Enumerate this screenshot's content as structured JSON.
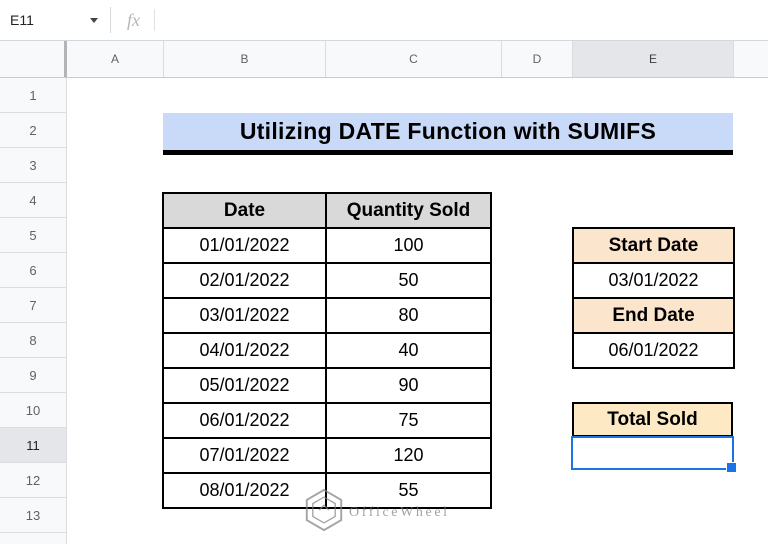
{
  "formula_bar": {
    "cell_reference": "E11",
    "fx_label": "fx",
    "formula_value": ""
  },
  "columns": {
    "headers": [
      "A",
      "B",
      "C",
      "D",
      "E"
    ],
    "selected": "E"
  },
  "rows": {
    "headers": [
      "1",
      "2",
      "3",
      "4",
      "5",
      "6",
      "7",
      "8",
      "9",
      "10",
      "11",
      "12",
      "13"
    ],
    "selected": "11"
  },
  "title": {
    "text": "Utilizing DATE Function with SUMIFS"
  },
  "sales_table": {
    "col_headers": [
      "Date",
      "Quantity Sold"
    ],
    "rows": [
      [
        "01/01/2022",
        "100"
      ],
      [
        "02/01/2022",
        "50"
      ],
      [
        "03/01/2022",
        "80"
      ],
      [
        "04/01/2022",
        "40"
      ],
      [
        "05/01/2022",
        "90"
      ],
      [
        "06/01/2022",
        "75"
      ],
      [
        "07/01/2022",
        "120"
      ],
      [
        "08/01/2022",
        "55"
      ]
    ]
  },
  "criteria": {
    "start_label": "Start Date",
    "start_value": "03/01/2022",
    "end_label": "End Date",
    "end_value": "06/01/2022"
  },
  "result": {
    "label": "Total Sold",
    "value": ""
  },
  "selection": {
    "active_cell": "E11"
  },
  "watermark": {
    "text": "OfficeWheel"
  },
  "colors": {
    "title_bg": "#c9daf8",
    "table_header_bg": "#d9d9d9",
    "criteria_label_bg": "#fce5cd",
    "result_label_bg": "#fde9c4",
    "selection_blue": "#1a73e8",
    "header_strip_bg": "#f8f9fa",
    "selected_header_bg": "#e4e6e9"
  }
}
